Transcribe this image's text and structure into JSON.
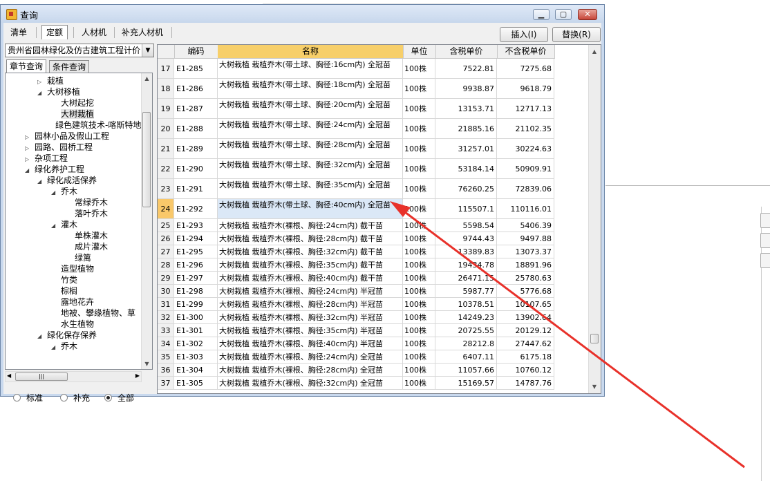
{
  "window": {
    "title": "查询"
  },
  "tabs": [
    "清单",
    "定额",
    "人材机",
    "补充人材机"
  ],
  "actions": {
    "insert": "插入(I)",
    "replace": "替换(R)"
  },
  "left": {
    "combo": "贵州省园林绿化及仿古建筑工程计价",
    "subtabs": [
      "章节查询",
      "条件查询"
    ],
    "tree": [
      {
        "label": "栽植",
        "toggle": "▷"
      },
      {
        "label": "大树移植",
        "toggle": "◢"
      },
      {
        "label": "大树起挖",
        "toggle": ""
      },
      {
        "label": "大树栽植",
        "toggle": ""
      },
      {
        "label": "绿色建筑技术-喀斯特地",
        "toggle": ""
      },
      {
        "label": "园林小品及假山工程",
        "toggle": "▷"
      },
      {
        "label": "园路、园桥工程",
        "toggle": "▷"
      },
      {
        "label": "杂项工程",
        "toggle": "▷"
      },
      {
        "label": "绿化养护工程",
        "toggle": "◢"
      },
      {
        "label": "绿化成活保养",
        "toggle": "◢"
      },
      {
        "label": "乔木",
        "toggle": "◢"
      },
      {
        "label": "常绿乔木",
        "toggle": ""
      },
      {
        "label": "落叶乔木",
        "toggle": ""
      },
      {
        "label": "灌木",
        "toggle": "◢"
      },
      {
        "label": "单株灌木",
        "toggle": ""
      },
      {
        "label": "成片灌木",
        "toggle": ""
      },
      {
        "label": "绿篱",
        "toggle": ""
      },
      {
        "label": "造型植物",
        "toggle": ""
      },
      {
        "label": "竹类",
        "toggle": ""
      },
      {
        "label": "棕榈",
        "toggle": ""
      },
      {
        "label": "露地花卉",
        "toggle": ""
      },
      {
        "label": "地被、攀缘植物、草",
        "toggle": ""
      },
      {
        "label": "水生植物",
        "toggle": ""
      },
      {
        "label": "绿化保存保养",
        "toggle": "◢"
      },
      {
        "label": "乔木",
        "toggle": "◢"
      }
    ],
    "radios": [
      "标准",
      "补充",
      "全部"
    ],
    "radio_selected": "全部"
  },
  "grid": {
    "headers": [
      "",
      "编码",
      "名称",
      "单位",
      "含税单价",
      "不含税单价"
    ],
    "rows": [
      {
        "idx": "17",
        "code": "E1-285",
        "name": "大树栽植 栽植乔木(带土球、胸径:16cm内) 全冠苗",
        "unit": "100株",
        "tax": "7522.81",
        "notax": "7275.68"
      },
      {
        "idx": "18",
        "code": "E1-286",
        "name": "大树栽植 栽植乔木(带土球、胸径:18cm内) 全冠苗",
        "unit": "100株",
        "tax": "9938.87",
        "notax": "9618.79"
      },
      {
        "idx": "19",
        "code": "E1-287",
        "name": "大树栽植 栽植乔木(带土球、胸径:20cm内) 全冠苗",
        "unit": "100株",
        "tax": "13153.71",
        "notax": "12717.13"
      },
      {
        "idx": "20",
        "code": "E1-288",
        "name": "大树栽植 栽植乔木(带土球、胸径:24cm内) 全冠苗",
        "unit": "100株",
        "tax": "21885.16",
        "notax": "21102.35"
      },
      {
        "idx": "21",
        "code": "E1-289",
        "name": "大树栽植 栽植乔木(带土球、胸径:28cm内) 全冠苗",
        "unit": "100株",
        "tax": "31257.01",
        "notax": "30224.63"
      },
      {
        "idx": "22",
        "code": "E1-290",
        "name": "大树栽植 栽植乔木(带土球、胸径:32cm内) 全冠苗",
        "unit": "100株",
        "tax": "53184.14",
        "notax": "50909.91"
      },
      {
        "idx": "23",
        "code": "E1-291",
        "name": "大树栽植 栽植乔木(带土球、胸径:35cm内) 全冠苗",
        "unit": "100株",
        "tax": "76260.25",
        "notax": "72839.06"
      },
      {
        "idx": "24",
        "code": "E1-292",
        "name": "大树栽植 栽植乔木(带土球、胸径:40cm内) 全冠苗",
        "unit": "100株",
        "tax": "115507.1",
        "notax": "110116.01"
      },
      {
        "idx": "25",
        "code": "E1-293",
        "name": "大树栽植 栽植乔木(裸根、胸径:24cm内) 截干苗",
        "unit": "100株",
        "tax": "5598.54",
        "notax": "5406.39"
      },
      {
        "idx": "26",
        "code": "E1-294",
        "name": "大树栽植 栽植乔木(裸根、胸径:28cm内) 截干苗",
        "unit": "100株",
        "tax": "9744.43",
        "notax": "9497.88"
      },
      {
        "idx": "27",
        "code": "E1-295",
        "name": "大树栽植 栽植乔木(裸根、胸径:32cm内) 截干苗",
        "unit": "100株",
        "tax": "13389.83",
        "notax": "13073.37"
      },
      {
        "idx": "28",
        "code": "E1-296",
        "name": "大树栽植 栽植乔木(裸根、胸径:35cm内) 截干苗",
        "unit": "100株",
        "tax": "19434.78",
        "notax": "18891.96"
      },
      {
        "idx": "29",
        "code": "E1-297",
        "name": "大树栽植 栽植乔木(裸根、胸径:40cm内) 截干苗",
        "unit": "100株",
        "tax": "26471.15",
        "notax": "25780.63"
      },
      {
        "idx": "30",
        "code": "E1-298",
        "name": "大树栽植 栽植乔木(裸根、胸径:24cm内) 半冠苗",
        "unit": "100株",
        "tax": "5987.77",
        "notax": "5776.68"
      },
      {
        "idx": "31",
        "code": "E1-299",
        "name": "大树栽植 栽植乔木(裸根、胸径:28cm内) 半冠苗",
        "unit": "100株",
        "tax": "10378.51",
        "notax": "10107.65"
      },
      {
        "idx": "32",
        "code": "E1-300",
        "name": "大树栽植 栽植乔木(裸根、胸径:32cm内) 半冠苗",
        "unit": "100株",
        "tax": "14249.23",
        "notax": "13902.64"
      },
      {
        "idx": "33",
        "code": "E1-301",
        "name": "大树栽植 栽植乔木(裸根、胸径:35cm内) 半冠苗",
        "unit": "100株",
        "tax": "20725.55",
        "notax": "20129.12"
      },
      {
        "idx": "34",
        "code": "E1-302",
        "name": "大树栽植 栽植乔木(裸根、胸径:40cm内) 半冠苗",
        "unit": "100株",
        "tax": "28212.8",
        "notax": "27447.62"
      },
      {
        "idx": "35",
        "code": "E1-303",
        "name": "大树栽植 栽植乔木(裸根、胸径:24cm内) 全冠苗",
        "unit": "100株",
        "tax": "6407.11",
        "notax": "6175.18"
      },
      {
        "idx": "36",
        "code": "E1-304",
        "name": "大树栽植 栽植乔木(裸根、胸径:28cm内) 全冠苗",
        "unit": "100株",
        "tax": "11057.66",
        "notax": "10760.12"
      },
      {
        "idx": "37",
        "code": "E1-305",
        "name": "大树栽植 栽植乔木(裸根、胸径:32cm内) 全冠苗",
        "unit": "100株",
        "tax": "15169.57",
        "notax": "14787.76"
      }
    ],
    "selected_idx": "24"
  },
  "colors": {
    "annotation_arrow": "#e8312a",
    "header_highlight": "#f7cf6a",
    "selected_index": "#f9c86a"
  }
}
